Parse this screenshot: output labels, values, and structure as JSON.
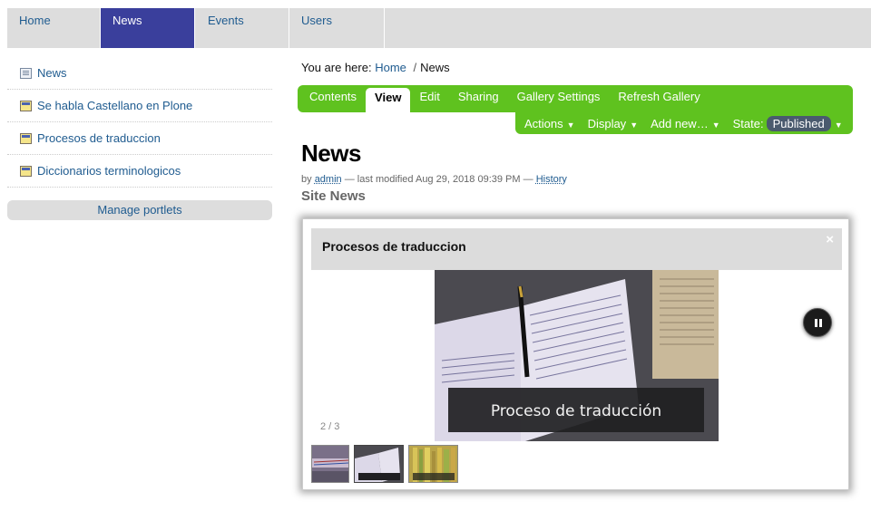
{
  "topnav": {
    "tabs": [
      {
        "label": "Home"
      },
      {
        "label": "News"
      },
      {
        "label": "Events"
      },
      {
        "label": "Users"
      }
    ]
  },
  "sidebar": {
    "items": [
      {
        "label": "News",
        "icon": "news-folder-icon"
      },
      {
        "label": "Se habla Castellano en Plone",
        "icon": "page-icon"
      },
      {
        "label": "Procesos de traduccion",
        "icon": "page-icon"
      },
      {
        "label": "Diccionarios terminologicos",
        "icon": "page-icon"
      }
    ],
    "manage_label": "Manage portlets"
  },
  "breadcrumb": {
    "prefix": "You are here:",
    "home": "Home",
    "separator": "/",
    "current": "News"
  },
  "editbar": {
    "tabs": [
      "Contents",
      "View",
      "Edit",
      "Sharing",
      "Gallery Settings",
      "Refresh Gallery"
    ],
    "active_tab": "View",
    "menus": {
      "actions": "Actions",
      "display": "Display",
      "add_new": "Add new…",
      "state_label": "State:",
      "state_value": "Published",
      "arrow": "▼"
    },
    "color": "#5fc21f"
  },
  "content": {
    "title": "News",
    "byline": {
      "by": "by",
      "author": "admin",
      "modified": "— last modified Aug 29, 2018 09:39 PM —",
      "history": "History"
    },
    "description": "Site News"
  },
  "gallery": {
    "title": "Procesos de traduccion",
    "close": "×",
    "image_caption": "Proceso de traducción",
    "counter": "2 / 3",
    "thumbnail_count": 3
  }
}
